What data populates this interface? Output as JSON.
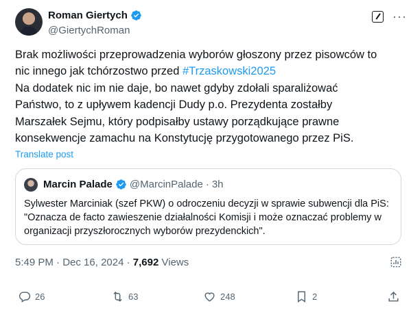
{
  "author": {
    "name": "Roman Giertych",
    "handle": "@GiertychRoman"
  },
  "tweet": {
    "text_1": "Brak możliwości przeprowadzenia wyborów głoszony przez pisowców to\nnic innego jak tchórzostwo przed ",
    "hashtag": "#Trzaskowski2025",
    "text_2": "\nNa dodatek nic im nie daje, bo nawet gdyby zdołali sparaliżować\nPaństwo, to z upływem kadencji Dudy p.o. Prezydenta zostałby\nMarszałek Sejmu, który podpisałby ustawy porządkujące prawne\nkonsekwencje zamachu na Konstytucję przygotowanego przez PiS.",
    "translate_label": "Translate post"
  },
  "quote": {
    "name": "Marcin Palade",
    "handle": "@MarcinPalade",
    "separator": "·",
    "time": "3h",
    "text": "Sylwester Marciniak (szef PKW) o odroczeniu decyzji w sprawie subwencji dla PiS: \"Oznacza de facto zawieszenie działalności Komisji i może oznaczać problemy w organizacji przyszłorocznych wyborów prezydenckich\"."
  },
  "meta": {
    "time": "5:49 PM",
    "date": "Dec 16, 2024",
    "separator": "·",
    "views_count": "7,692",
    "views_label": "Views"
  },
  "actions": {
    "replies": "26",
    "reposts": "63",
    "likes": "248",
    "bookmarks": "2"
  },
  "icons": {
    "verified": "verified-badge-icon",
    "accent": "#1d9bf0",
    "secondary_text": "#536471"
  }
}
